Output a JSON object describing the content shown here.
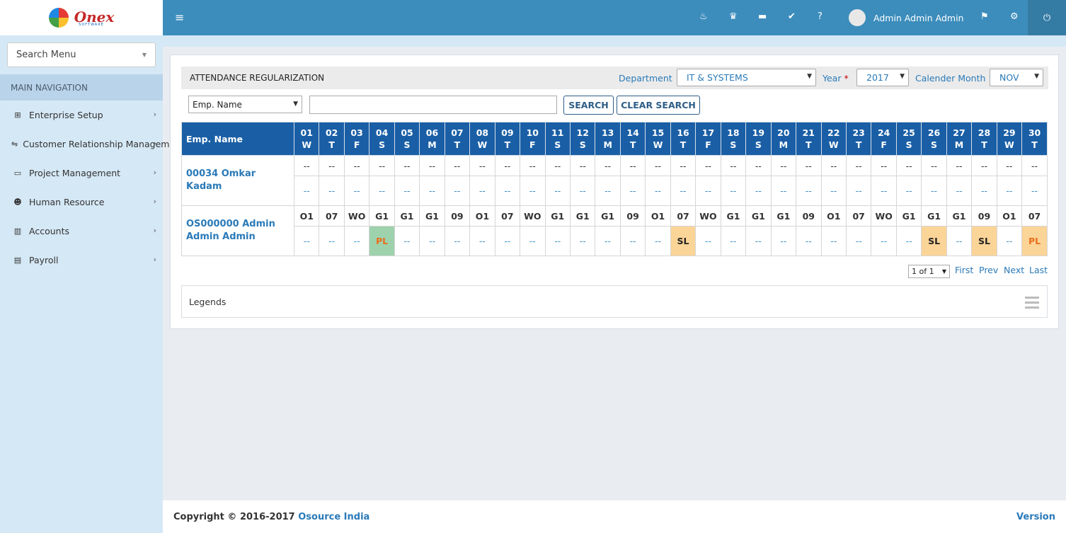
{
  "brand": {
    "logo_text": "Onex",
    "logo_sub": "SOFTWARE"
  },
  "sidebar": {
    "search_menu": "Search Menu",
    "nav_header": "MAIN NAVIGATION",
    "items": [
      {
        "label": "Enterprise Setup",
        "icon": "sitemap-icon"
      },
      {
        "label": "Customer Relationship Management",
        "icon": "handshake-icon"
      },
      {
        "label": "Project Management",
        "icon": "desktop-icon"
      },
      {
        "label": "Human Resource",
        "icon": "users-icon"
      },
      {
        "label": "Accounts",
        "icon": "bar-chart-icon"
      },
      {
        "label": "Payroll",
        "icon": "file-icon"
      }
    ]
  },
  "topbar": {
    "user_name": "Admin Admin Admin"
  },
  "page": {
    "title": "ATTENDANCE REGULARIZATION",
    "department_label": "Department",
    "department_value": "IT & SYSTEMS",
    "year_label": "Year",
    "year_required": "*",
    "year_value": "2017",
    "month_label": "Calender Month",
    "month_value": "NOV",
    "emp_filter_value": "Emp. Name",
    "search_value": "",
    "search_button": "SEARCH",
    "clear_button": "CLEAR SEARCH"
  },
  "table": {
    "name_header": "Emp. Name",
    "days": [
      [
        "01",
        "W"
      ],
      [
        "02",
        "T"
      ],
      [
        "03",
        "F"
      ],
      [
        "04",
        "S"
      ],
      [
        "05",
        "S"
      ],
      [
        "06",
        "M"
      ],
      [
        "07",
        "T"
      ],
      [
        "08",
        "W"
      ],
      [
        "09",
        "T"
      ],
      [
        "10",
        "F"
      ],
      [
        "11",
        "S"
      ],
      [
        "12",
        "S"
      ],
      [
        "13",
        "M"
      ],
      [
        "14",
        "T"
      ],
      [
        "15",
        "W"
      ],
      [
        "16",
        "T"
      ],
      [
        "17",
        "F"
      ],
      [
        "18",
        "S"
      ],
      [
        "19",
        "S"
      ],
      [
        "20",
        "M"
      ],
      [
        "21",
        "T"
      ],
      [
        "22",
        "W"
      ],
      [
        "23",
        "T"
      ],
      [
        "24",
        "F"
      ],
      [
        "25",
        "S"
      ],
      [
        "26",
        "S"
      ],
      [
        "27",
        "M"
      ],
      [
        "28",
        "T"
      ],
      [
        "29",
        "W"
      ],
      [
        "30",
        "T"
      ]
    ],
    "rows": [
      {
        "name": "00034 Omkar Kadam",
        "shifts": [
          "--",
          "--",
          "--",
          "--",
          "--",
          "--",
          "--",
          "--",
          "--",
          "--",
          "--",
          "--",
          "--",
          "--",
          "--",
          "--",
          "--",
          "--",
          "--",
          "--",
          "--",
          "--",
          "--",
          "--",
          "--",
          "--",
          "--",
          "--",
          "--",
          "--"
        ],
        "leaves": [
          "--",
          "--",
          "--",
          "--",
          "--",
          "--",
          "--",
          "--",
          "--",
          "--",
          "--",
          "--",
          "--",
          "--",
          "--",
          "--",
          "--",
          "--",
          "--",
          "--",
          "--",
          "--",
          "--",
          "--",
          "--",
          "--",
          "--",
          "--",
          "--",
          "--"
        ],
        "leave_styles": [
          "",
          "",
          "",
          "",
          "",
          "",
          "",
          "",
          "",
          "",
          "",
          "",
          "",
          "",
          "",
          "",
          "",
          "",
          "",
          "",
          "",
          "",
          "",
          "",
          "",
          "",
          "",
          "",
          "",
          ""
        ]
      },
      {
        "name": "OS000000 Admin Admin Admin",
        "shifts": [
          "O1",
          "07",
          "WO",
          "G1",
          "G1",
          "G1",
          "09",
          "O1",
          "07",
          "WO",
          "G1",
          "G1",
          "G1",
          "09",
          "O1",
          "07",
          "WO",
          "G1",
          "G1",
          "G1",
          "09",
          "O1",
          "07",
          "WO",
          "G1",
          "G1",
          "G1",
          "09",
          "O1",
          "07"
        ],
        "leaves": [
          "--",
          "--",
          "--",
          "PL",
          "--",
          "--",
          "--",
          "--",
          "--",
          "--",
          "--",
          "--",
          "--",
          "--",
          "--",
          "SL",
          "--",
          "--",
          "--",
          "--",
          "--",
          "--",
          "--",
          "--",
          "--",
          "SL",
          "--",
          "SL",
          "--",
          "PL"
        ],
        "leave_styles": [
          "",
          "",
          "",
          "pl-green",
          "",
          "",
          "",
          "",
          "",
          "",
          "",
          "",
          "",
          "",
          "",
          "sl",
          "",
          "",
          "",
          "",
          "",
          "",
          "",
          "",
          "",
          "sl",
          "",
          "sl",
          "",
          "pl-orange"
        ]
      }
    ]
  },
  "pager": {
    "page_select": "1 of 1",
    "first": "First",
    "prev": "Prev",
    "next": "Next",
    "last": "Last"
  },
  "legends": {
    "label": "Legends"
  },
  "footer": {
    "copyright": "Copyright © 2016-2017",
    "company": "Osource India",
    "version": "Version"
  },
  "colors": {
    "topbar": "#3c8dbc",
    "table_header": "#1a5fa6",
    "sidebar": "#d5e8f5",
    "pl_green": "#9ed2ad",
    "sl_orange": "#fbd497"
  }
}
